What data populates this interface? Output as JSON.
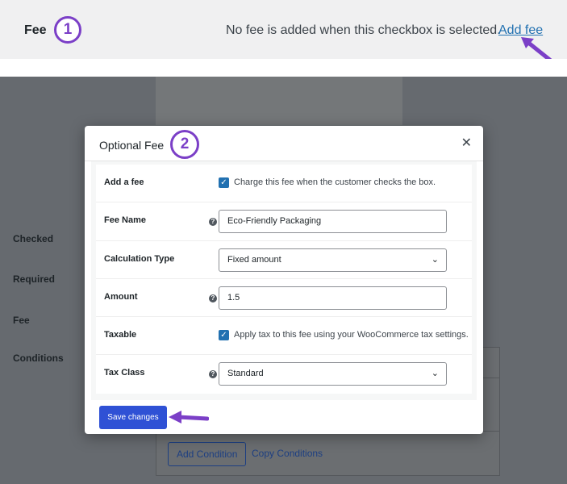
{
  "annotation": {
    "fee_title": "Fee",
    "badge_one": "1",
    "note": "No fee is added when this checkbox is selected.",
    "add_fee_link": "Add fee",
    "badge_two": "2",
    "arrow_color": "#7b3fc7"
  },
  "background_page": {
    "labels": [
      "Checked",
      "Required",
      "Fee",
      "Conditions"
    ],
    "add_condition_button": "Add Condition",
    "copy_conditions_link": "Copy Conditions"
  },
  "modal": {
    "title": "Optional Fee",
    "close_icon": "close-icon",
    "rows": {
      "add_fee": {
        "label": "Add a fee",
        "checked": true,
        "text": "Charge this fee when the customer checks the box."
      },
      "fee_name": {
        "label": "Fee Name",
        "value": "Eco-Friendly Packaging"
      },
      "calculation_type": {
        "label": "Calculation Type",
        "value": "Fixed amount"
      },
      "amount": {
        "label": "Amount",
        "value": "1.5"
      },
      "taxable": {
        "label": "Taxable",
        "checked": true,
        "text": "Apply tax to this fee using your WooCommerce tax settings."
      },
      "tax_class": {
        "label": "Tax Class",
        "value": "Standard"
      }
    },
    "save_button": "Save changes",
    "accent_color": "#2f51d5"
  }
}
